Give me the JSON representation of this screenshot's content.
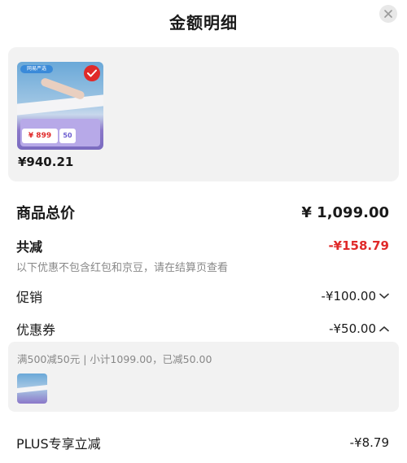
{
  "header": {
    "title": "金额明细"
  },
  "product": {
    "price": "¥940.21",
    "thumb": {
      "brand": "网易严选",
      "promo_price": "¥ 899",
      "promo_badge": "50"
    }
  },
  "summary": {
    "total_label": "商品总价",
    "total_value": "¥ 1,099.00",
    "discount_label": "共减",
    "discount_value": "-¥158.79",
    "note": "以下优惠不包含红包和京豆，请在结算页查看",
    "promo_label": "促销",
    "promo_value": "-¥100.00",
    "coupon_label": "优惠券",
    "coupon_value": "-¥50.00",
    "coupon_detail": "满500减50元 | 小计1099.00，已减50.00",
    "plus_label": "PLUS专享立减",
    "plus_value": "-¥8.79"
  },
  "colors": {
    "accent_red": "#e02a2a",
    "card_bg": "#f2f2f2",
    "muted_text": "#888888"
  },
  "icons": [
    "close-icon",
    "check-icon",
    "chevron-down-icon",
    "chevron-up-icon"
  ]
}
